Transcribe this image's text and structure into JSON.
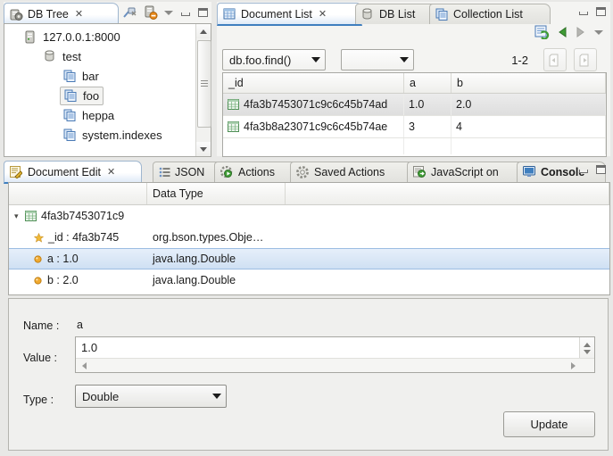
{
  "db_tree": {
    "tab_label": "DB Tree",
    "close_glyph": "✕",
    "toolbar": {
      "disconnect_icon": "disconnect-icon",
      "server_remove_icon": "server-remove-icon",
      "view_menu_icon": "view-menu-chevron-icon",
      "minimize_icon": "minimize-icon",
      "maximize_icon": "maximize-icon"
    },
    "nodes": [
      {
        "label": "127.0.0.1:8000",
        "icon": "server-icon",
        "indent": 0,
        "selected": false
      },
      {
        "label": "test",
        "icon": "database-icon",
        "indent": 1,
        "selected": false
      },
      {
        "label": "bar",
        "icon": "collection-icon",
        "indent": 2,
        "selected": false
      },
      {
        "label": "foo",
        "icon": "collection-icon",
        "indent": 2,
        "selected": true
      },
      {
        "label": "heppa",
        "icon": "collection-icon",
        "indent": 2,
        "selected": false
      },
      {
        "label": "system.indexes",
        "icon": "collection-icon",
        "indent": 2,
        "selected": false
      }
    ]
  },
  "document_list": {
    "tabs": [
      {
        "label": "Document List",
        "icon": "document-list-icon",
        "active": true,
        "closable": true
      },
      {
        "label": "DB List",
        "icon": "db-list-icon",
        "active": false,
        "closable": false
      },
      {
        "label": "Collection List",
        "icon": "collection-list-icon",
        "active": false,
        "closable": false
      }
    ],
    "close_glyph": "✕",
    "toolbar": {
      "refresh_icon": "refresh-icon",
      "back_icon": "arrow-left-icon",
      "forward_icon": "arrow-right-icon",
      "view_menu_icon": "view-menu-chevron-icon",
      "minimize_icon": "minimize-icon",
      "maximize_icon": "maximize-icon"
    },
    "query_combo": {
      "value": "db.foo.find()"
    },
    "field_combo": {
      "value": ""
    },
    "range_label": "1-2",
    "prev_page_icon": "prev-page-icon",
    "next_page_icon": "next-page-icon",
    "columns": [
      "_id",
      "a",
      "b"
    ],
    "rows": [
      {
        "icon": "document-icon",
        "_id": "4fa3b7453071c9c6c45b74ad",
        "a": "1.0",
        "b": "2.0",
        "selected": true
      },
      {
        "icon": "document-icon",
        "_id": "4fa3b8a23071c9c6c45b74ae",
        "a": "3",
        "b": "4",
        "selected": false
      }
    ]
  },
  "bottom": {
    "tabs": [
      {
        "label": "Document Edit",
        "icon": "document-edit-icon",
        "active": true,
        "bold": false,
        "closable": true
      },
      {
        "label": "JSON",
        "icon": "json-icon",
        "active": false,
        "bold": false,
        "closable": false
      },
      {
        "label": "Actions",
        "icon": "actions-icon",
        "active": false,
        "bold": false,
        "closable": false
      },
      {
        "label": "Saved Actions",
        "icon": "saved-actions-icon",
        "active": false,
        "bold": false,
        "closable": false
      },
      {
        "label": "JavaScript on",
        "icon": "javascript-icon",
        "active": false,
        "bold": false,
        "closable": false
      },
      {
        "label": "Console",
        "icon": "console-icon",
        "active": false,
        "bold": true,
        "closable": false
      }
    ],
    "close_glyph": "✕",
    "minimize_icon": "minimize-icon",
    "maximize_icon": "maximize-icon",
    "tree": {
      "columns": [
        "",
        "Data Type",
        ""
      ],
      "rows": [
        {
          "expander": "▾",
          "icon": "document-icon",
          "label": "4fa3b7453071c9",
          "type": "",
          "indent": 0,
          "selected": false
        },
        {
          "expander": "",
          "icon": "key-star-icon",
          "label": "_id : 4fa3b745",
          "type": "org.bson.types.Obje…",
          "indent": 1,
          "selected": false
        },
        {
          "expander": "",
          "icon": "field-dot-icon",
          "label": "a : 1.0",
          "type": "java.lang.Double",
          "indent": 1,
          "selected": true
        },
        {
          "expander": "",
          "icon": "field-dot-icon",
          "label": "b : 2.0",
          "type": "java.lang.Double",
          "indent": 1,
          "selected": false
        }
      ]
    },
    "form": {
      "name_label": "Name :",
      "name_value": "a",
      "value_label": "Value :",
      "value_text": "1.0",
      "type_label": "Type :",
      "type_value": "Double",
      "update_label": "Update"
    }
  },
  "colors": {
    "accent": "#3f7fbf",
    "selection_blue": "#cfe3f7",
    "panel_bg": "#f4f4f2",
    "window_bg": "#e8e8e6",
    "icon_green": "#3f9c35",
    "icon_orange": "#e8891a"
  }
}
